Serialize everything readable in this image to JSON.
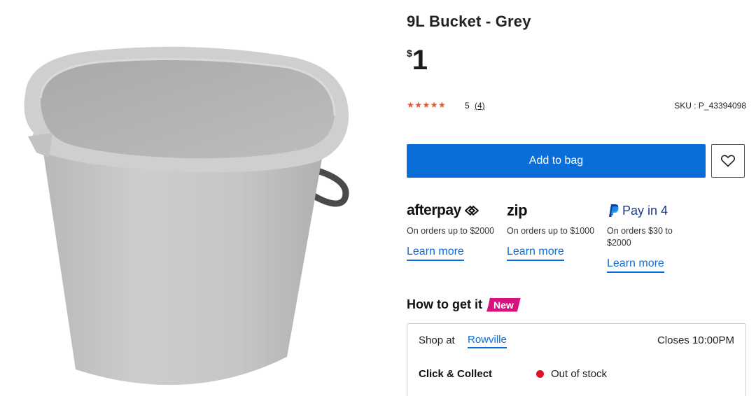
{
  "product": {
    "title": "9L Bucket - Grey",
    "currency": "$",
    "price": "1",
    "rating_stars": "★★★★★",
    "rating_value": "5",
    "rating_count": "(4)",
    "sku": "SKU : P_43394098"
  },
  "actions": {
    "add_to_bag": "Add to bag",
    "wishlist_icon": "heart-icon"
  },
  "payments": [
    {
      "brand": "afterpay",
      "description": "On orders up to $2000",
      "link": "Learn more"
    },
    {
      "brand": "zip",
      "description": "On orders up to $1000",
      "link": "Learn more"
    },
    {
      "brand": "Pay in 4",
      "description": "On orders $30 to $2000",
      "link": "Learn more"
    }
  ],
  "fulfilment": {
    "heading": "How to get it",
    "badge": "New",
    "shop_at": "Shop at",
    "store": "Rowville",
    "closes": "Closes 10:00PM",
    "options": [
      {
        "label": "Click & Collect",
        "status": "Out of stock"
      }
    ]
  },
  "colors": {
    "accent": "#0a6ed8",
    "star": "#e8542b",
    "badge": "#d6127e",
    "out_of_stock": "#e0102a",
    "product_grey": "#c4c4c4"
  }
}
